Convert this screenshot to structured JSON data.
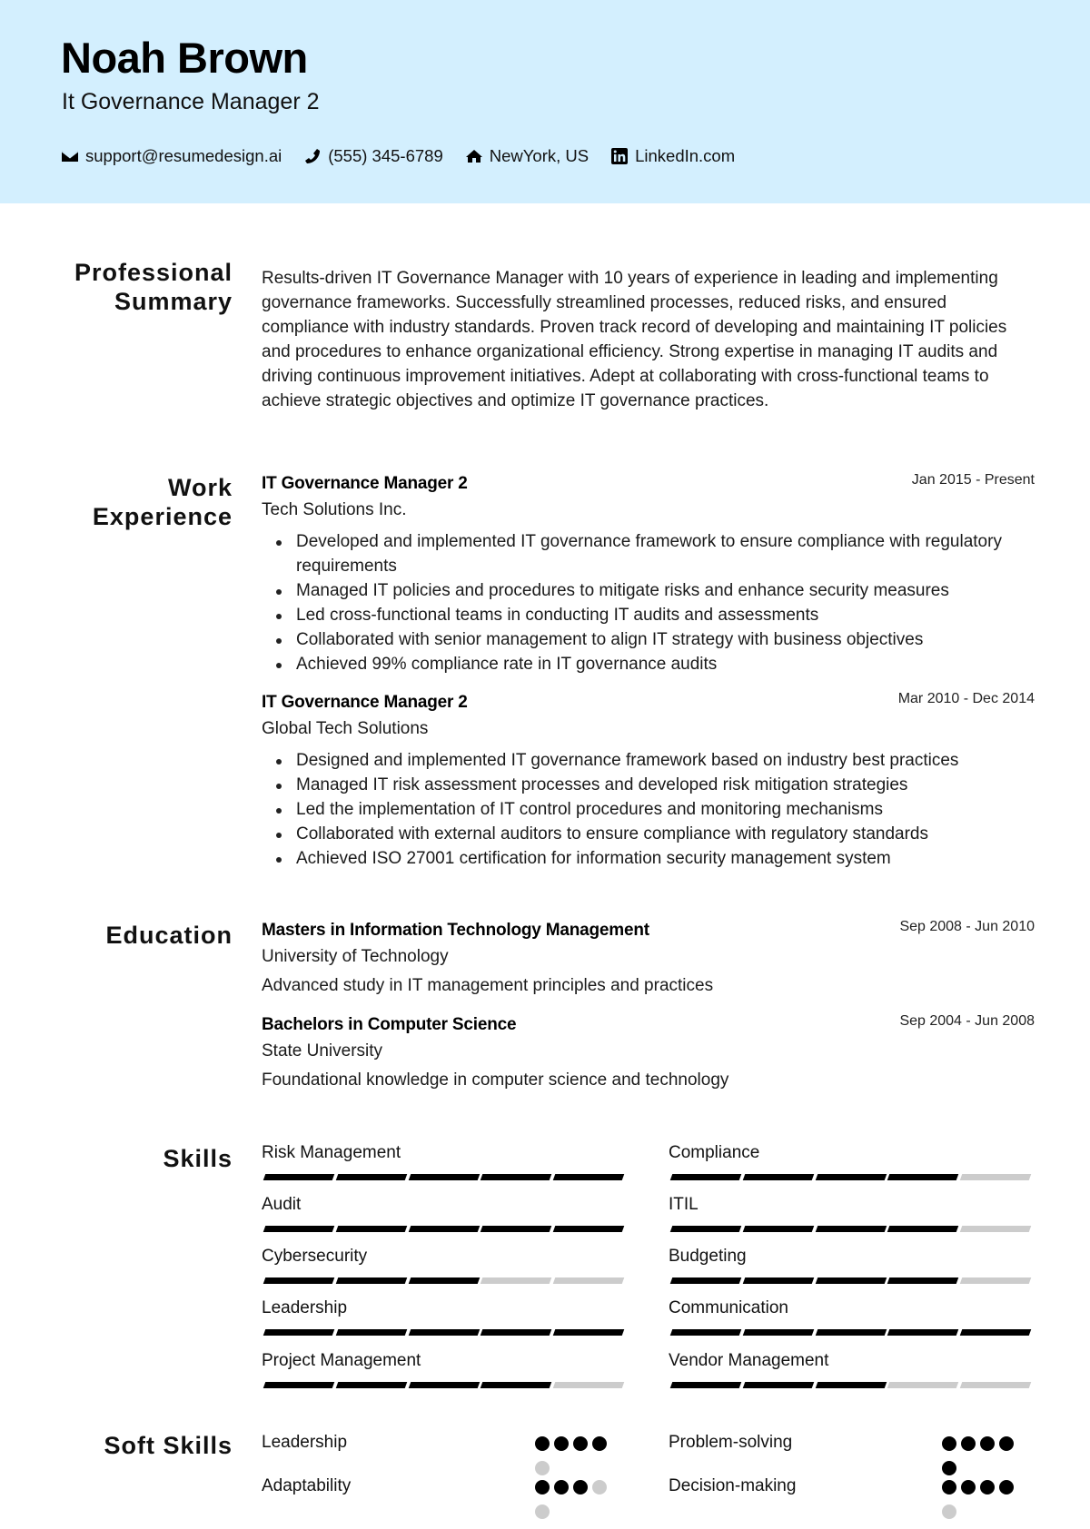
{
  "header": {
    "name": "Noah Brown",
    "title": "It Governance Manager 2",
    "background_color": "#d3effe",
    "contacts": [
      {
        "icon": "envelope-icon",
        "text": "support@resumedesign.ai"
      },
      {
        "icon": "phone-icon",
        "text": "(555) 345-6789"
      },
      {
        "icon": "home-icon",
        "text": "NewYork, US"
      },
      {
        "icon": "linkedin-icon",
        "text": "LinkedIn.com"
      }
    ]
  },
  "sections": {
    "summary_title_1": "Professional",
    "summary_title_2": "Summary",
    "work_title_1": "Work",
    "work_title_2": "Experience",
    "education_title": "Education",
    "skills_title": "Skills",
    "soft_skills_title": "Soft Skills"
  },
  "summary": "Results-driven IT Governance Manager with 10 years of experience in leading and implementing governance frameworks. Successfully streamlined processes, reduced risks, and ensured compliance with industry standards. Proven track record of developing and maintaining IT policies and procedures to enhance organizational efficiency. Strong expertise in managing IT audits and driving continuous improvement initiatives. Adept at collaborating with cross-functional teams to achieve strategic objectives and optimize IT governance practices.",
  "experience": [
    {
      "role": "IT Governance Manager 2",
      "company": "Tech Solutions Inc.",
      "dates": "Jan 2015 - Present",
      "bullets": [
        "Developed and implemented IT governance framework to ensure compliance with regulatory requirements",
        "Managed IT policies and procedures to mitigate risks and enhance security measures",
        "Led cross-functional teams in conducting IT audits and assessments",
        "Collaborated with senior management to align IT strategy with business objectives",
        "Achieved 99% compliance rate in IT governance audits"
      ]
    },
    {
      "role": "IT Governance Manager 2",
      "company": "Global Tech Solutions",
      "dates": "Mar 2010 - Dec 2014",
      "bullets": [
        "Designed and implemented IT governance framework based on industry best practices",
        "Managed IT risk assessment processes and developed risk mitigation strategies",
        "Led the implementation of IT control procedures and monitoring mechanisms",
        "Collaborated with external auditors to ensure compliance with regulatory standards",
        "Achieved ISO 27001 certification for information security management system"
      ]
    }
  ],
  "education": [
    {
      "degree": "Masters in Information Technology Management",
      "school": "University of Technology",
      "dates": "Sep 2008 - Jun 2010",
      "description": "Advanced study in IT management principles and practices"
    },
    {
      "degree": "Bachelors in Computer Science",
      "school": "State University",
      "dates": "Sep 2004 - Jun 2008",
      "description": "Foundational knowledge in computer science and technology"
    }
  ],
  "skills": {
    "max": 5,
    "left": [
      {
        "name": "Risk Management",
        "level": 5
      },
      {
        "name": "Audit",
        "level": 5
      },
      {
        "name": "Cybersecurity",
        "level": 3
      },
      {
        "name": "Leadership",
        "level": 5
      },
      {
        "name": "Project Management",
        "level": 4
      }
    ],
    "right": [
      {
        "name": "Compliance",
        "level": 4
      },
      {
        "name": "ITIL",
        "level": 4
      },
      {
        "name": "Budgeting",
        "level": 4
      },
      {
        "name": "Communication",
        "level": 5
      },
      {
        "name": "Vendor Management",
        "level": 3
      }
    ]
  },
  "soft_skills": {
    "max": 5,
    "left": [
      {
        "name": "Leadership",
        "level": 4
      },
      {
        "name": "Adaptability",
        "level": 3
      }
    ],
    "right": [
      {
        "name": "Problem-solving",
        "level": 5
      },
      {
        "name": "Decision-making",
        "level": 4
      }
    ]
  }
}
